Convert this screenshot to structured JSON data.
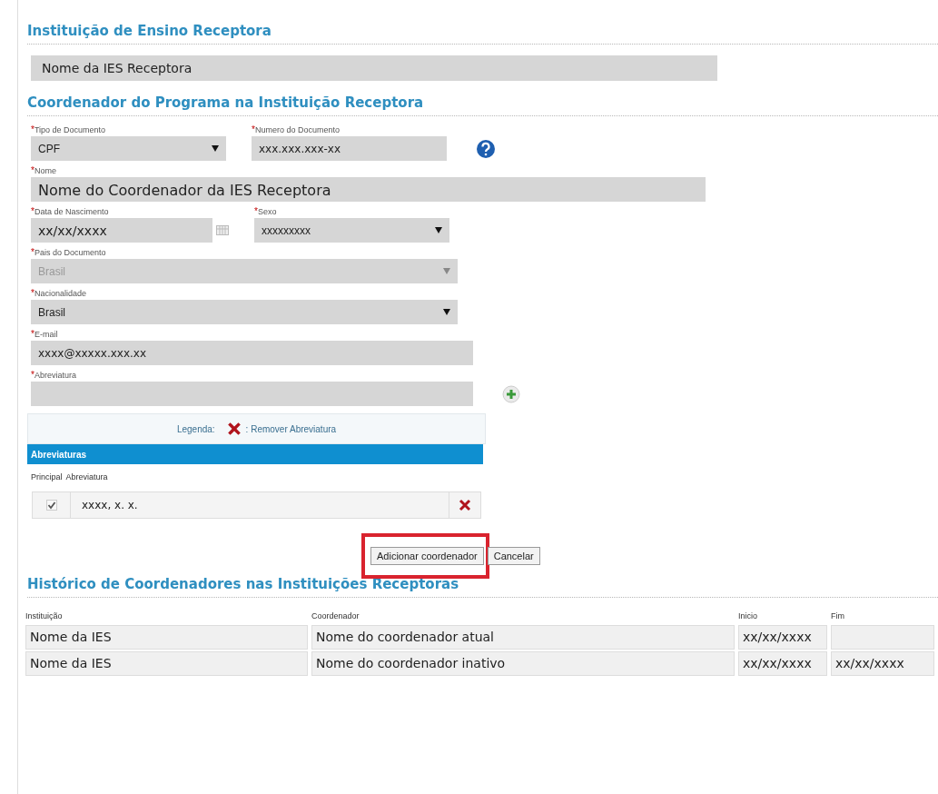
{
  "receptora": {
    "title": "Instituição de Ensino Receptora",
    "value": "Nome da IES Receptora"
  },
  "coordenador": {
    "title": "Coordenador do Programa na Instituição Receptora",
    "rows": [
      [
        {
          "kind": "select",
          "mark": "*",
          "label": "Tipo de Documento",
          "value": "CPF",
          "disabled": false
        },
        {
          "kind": "input",
          "mark": "*",
          "label": "Numero do Documento",
          "value": "xxx.xxx.xxx-xx",
          "help": true
        }
      ],
      [
        {
          "kind": "input",
          "mark": "*",
          "label": "Nome",
          "value": "Nome do Coordenador da IES Receptora"
        }
      ],
      [
        {
          "kind": "date",
          "mark": "*",
          "label": "Data de Nascimento",
          "value": "xx/xx/xxxx"
        },
        {
          "kind": "select",
          "mark": "*",
          "label": "Sexo",
          "value": "xxxxxxxxx",
          "disabled": false
        }
      ],
      [
        {
          "kind": "select",
          "mark": "*",
          "label": "Pais do Documento",
          "value": "Brasil",
          "disabled": true
        }
      ],
      [
        {
          "kind": "select",
          "mark": "*",
          "label": "Nacionalidade",
          "value": "Brasil",
          "disabled": false
        }
      ],
      [
        {
          "kind": "input",
          "mark": "*",
          "label": "E-mail",
          "value": "xxxx@xxxxx.xxx.xx"
        }
      ],
      [
        {
          "kind": "input",
          "mark": "*",
          "label": "Abreviatura",
          "add": true
        }
      ]
    ]
  },
  "legend": {
    "label": "Legenda:",
    "text": ": Remover Abreviatura"
  },
  "abreviaturas": {
    "title": "Abreviaturas",
    "columns": [
      "Principal",
      "Abreviatura"
    ],
    "rows": [
      {
        "checked": true,
        "value": "xxxx, x. x."
      }
    ]
  },
  "buttons": [
    {
      "label": "Adicionar coordenador",
      "highlighted": true
    },
    {
      "label": "Cancelar",
      "highlighted": false
    }
  ],
  "historico": {
    "title": "Histórico de Coordenadores nas Instituições Receptoras",
    "columns": [
      "Instituição",
      "Coordenador",
      "Inicio",
      "Fim"
    ],
    "rows": [
      [
        "Nome da IES",
        "Nome do coordenador atual",
        "xx/xx/xxxx",
        ""
      ],
      [
        "Nome da IES",
        "Nome do coordenador inativo",
        "xx/xx/xxxx",
        "xx/xx/xxxx"
      ]
    ]
  }
}
